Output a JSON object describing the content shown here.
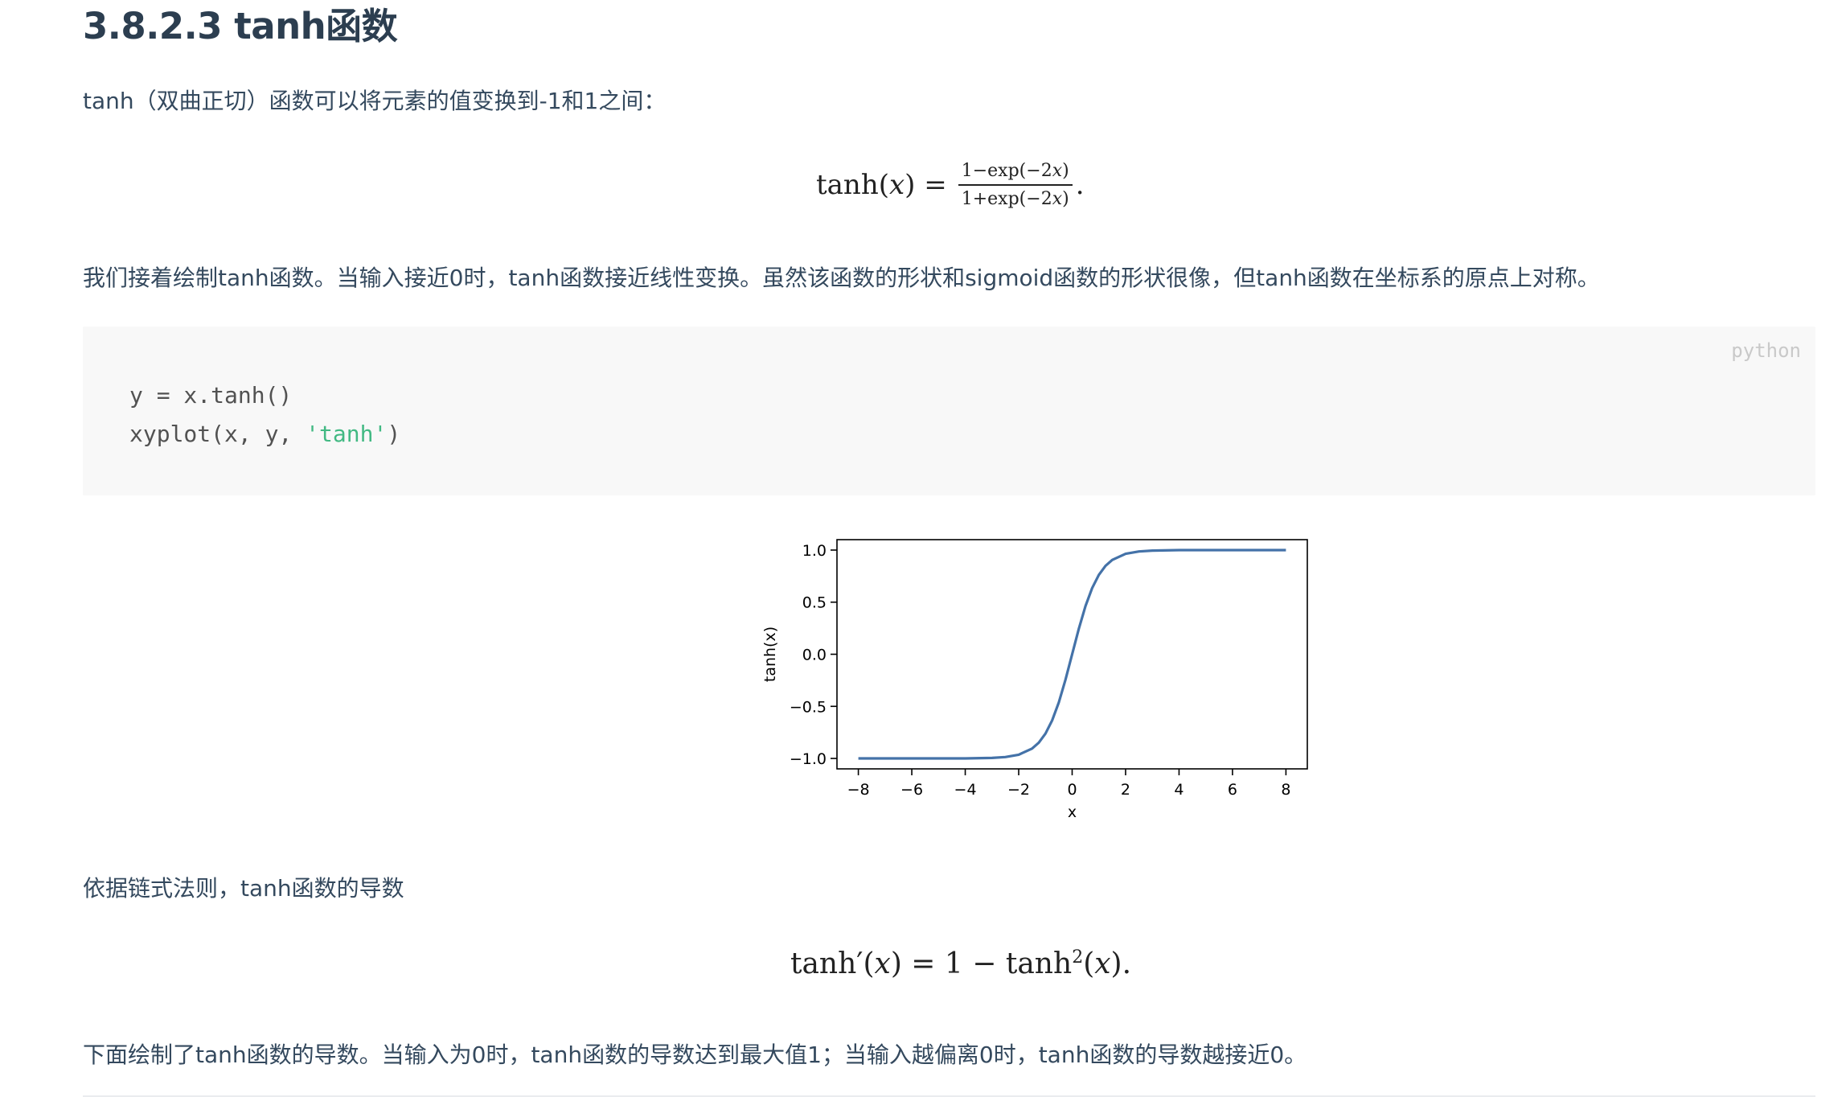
{
  "section_title": "3.8.2.3 tanh函数",
  "intro_text": "tanh（双曲正切）函数可以将元素的值变换到-1和1之间：",
  "formula1": {
    "lhs": "tanh(𝑥) =",
    "numerator": "1−exp(−2𝑥)",
    "denominator": "1+exp(−2𝑥)",
    "tail": "."
  },
  "desc_text": "我们接着绘制tanh函数。当输入接近0时，tanh函数接近线性变换。虽然该函数的形状和sigmoid函数的形状很像，但tanh函数在坐标系的原点上对称。",
  "code_block": {
    "language": "python",
    "line1": "y = x.tanh()",
    "line2_prefix": "xyplot(x, y, ",
    "line2_string": "'tanh'",
    "line2_suffix": ")"
  },
  "chart_data": {
    "type": "line",
    "title": "",
    "xlabel": "x",
    "ylabel": "tanh(x)",
    "xlim": [
      -8.8,
      8.8
    ],
    "ylim": [
      -1.1,
      1.1
    ],
    "xticks": [
      -8,
      -6,
      -4,
      -2,
      0,
      2,
      4,
      6,
      8
    ],
    "xtick_labels": [
      "−8",
      "−6",
      "−4",
      "−2",
      "0",
      "2",
      "4",
      "6",
      "8"
    ],
    "yticks": [
      -1.0,
      -0.5,
      0.0,
      0.5,
      1.0
    ],
    "ytick_labels": [
      "−1.0",
      "−0.5",
      "0.0",
      "0.5",
      "1.0"
    ],
    "grid": false,
    "line_color": "#4472a8",
    "series": [
      {
        "x": [
          -8,
          -7,
          -6,
          -5,
          -4,
          -3,
          -2.5,
          -2,
          -1.5,
          -1.25,
          -1,
          -0.75,
          -0.5,
          -0.25,
          0,
          0.25,
          0.5,
          0.75,
          1,
          1.25,
          1.5,
          2,
          2.5,
          3,
          4,
          5,
          6,
          7,
          8
        ],
        "y": [
          -1.0,
          -1.0,
          -1.0,
          -0.9999,
          -0.9993,
          -0.9951,
          -0.9866,
          -0.964,
          -0.9051,
          -0.8483,
          -0.7616,
          -0.6351,
          -0.4621,
          -0.2449,
          0.0,
          0.2449,
          0.4621,
          0.6351,
          0.7616,
          0.8483,
          0.9051,
          0.964,
          0.9866,
          0.9951,
          0.9993,
          0.9999,
          1.0,
          1.0,
          1.0
        ]
      }
    ]
  },
  "chain_rule_text": "依据链式法则，tanh函数的导数",
  "formula2": {
    "text_a": "tanh′(𝑥) = 1 − tanh",
    "superscript": "2",
    "text_b": "(𝑥)."
  },
  "final_text": "下面绘制了tanh函数的导数。当输入为0时，tanh函数的导数达到最大值1；当输入越偏离0时，tanh函数的导数越接近0。"
}
